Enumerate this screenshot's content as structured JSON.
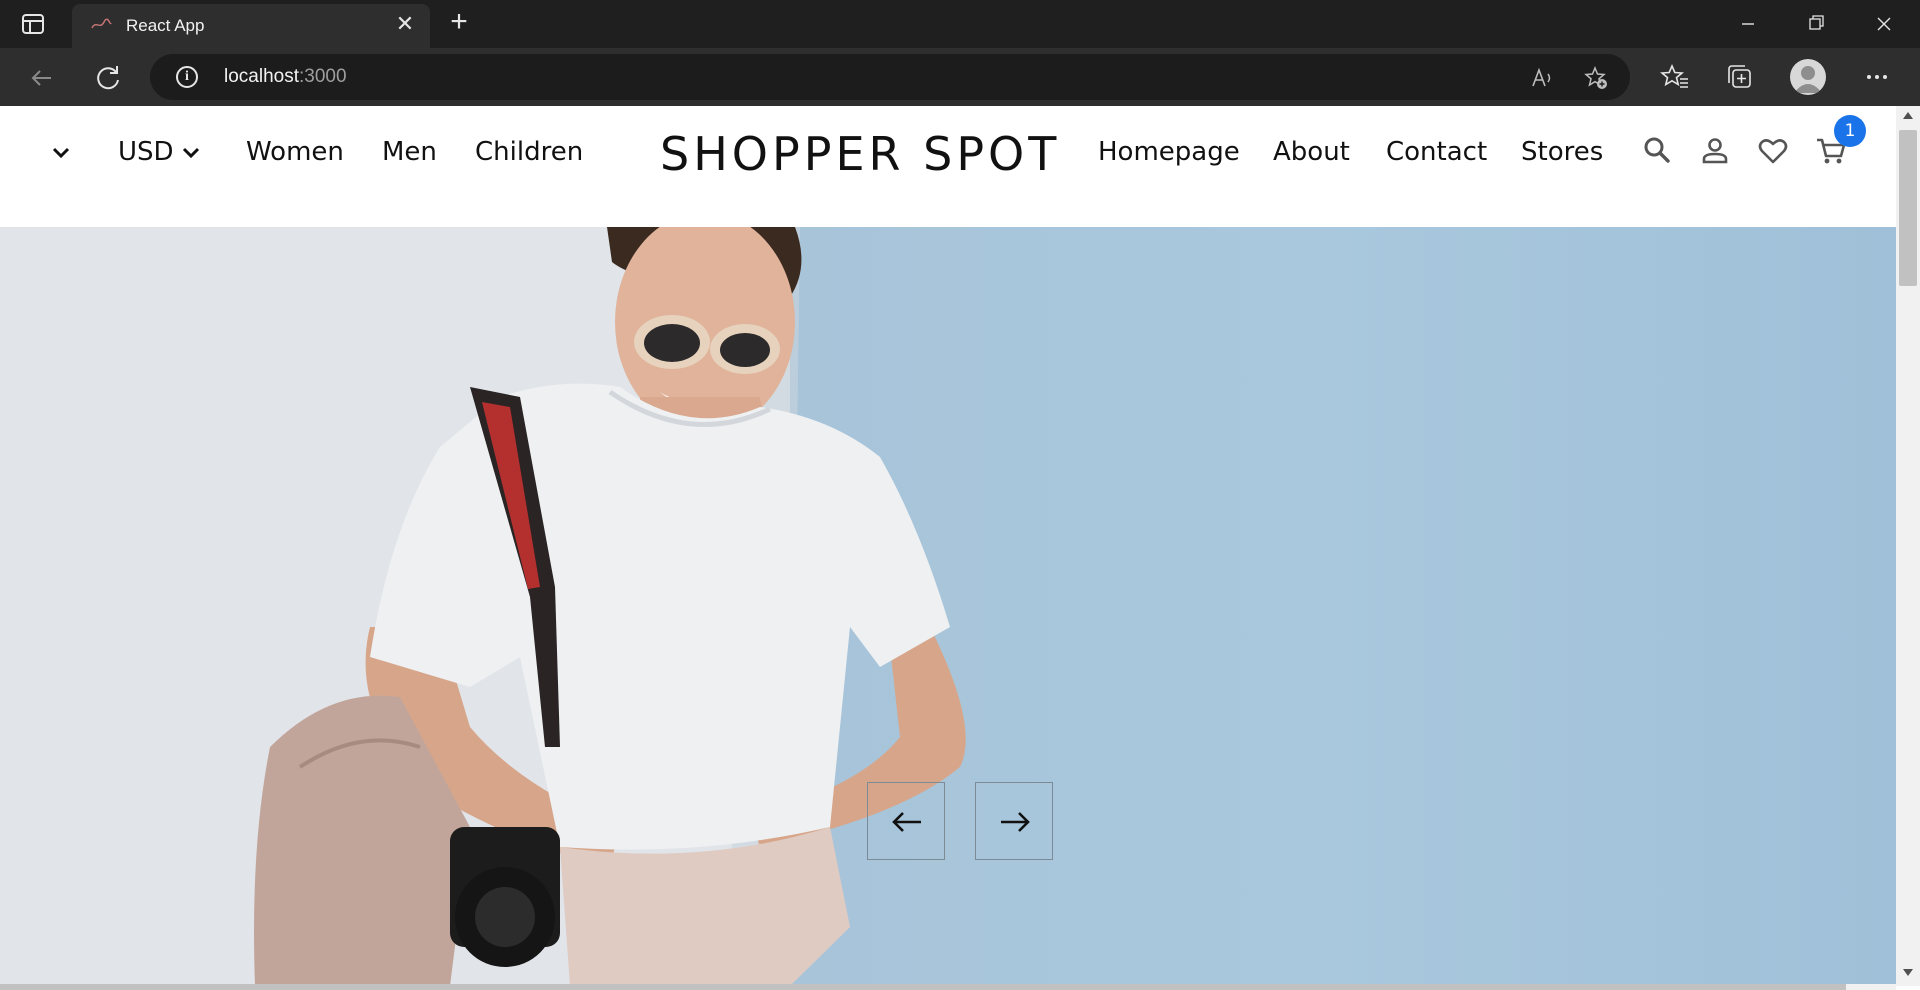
{
  "browser": {
    "tab": {
      "title": "React App",
      "close_glyph": "✕"
    },
    "new_tab_glyph": "+",
    "address": {
      "host": "localhost",
      "port": ":3000"
    },
    "icons": [
      "sidebar-icon",
      "back-icon",
      "reload-icon",
      "info-icon",
      "read-aloud-icon",
      "add-favorite-icon",
      "favorites-icon",
      "collections-icon",
      "profile-icon",
      "more-icon",
      "minimize-icon",
      "restore-icon",
      "close-icon"
    ]
  },
  "site": {
    "currency": "USD",
    "left_links": [
      "Women",
      "Men",
      "Children"
    ],
    "logo": "SHOPPER SPOT",
    "right_links": [
      "Homepage",
      "About",
      "Contact",
      "Stores"
    ],
    "cart_count": "1",
    "icons": [
      "language-chevron-icon",
      "currency-chevron-icon",
      "search-icon",
      "user-icon",
      "heart-icon",
      "cart-icon"
    ]
  },
  "hero": {
    "image_description_icon": "hero-photo",
    "prev_icon": "arrow-left-icon",
    "next_icon": "arrow-right-icon"
  },
  "colors": {
    "badge": "#1a73e8",
    "wall_blue": "#a9c8de",
    "wall_white": "#dde3e9"
  }
}
